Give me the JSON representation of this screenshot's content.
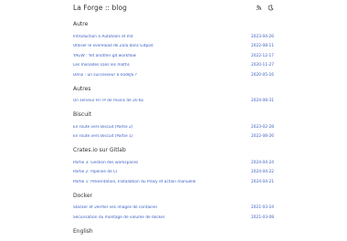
{
  "header": {
    "title": "La Forge :: blog",
    "icons": [
      "rss-icon",
      "moon-icon"
    ]
  },
  "categories": [
    {
      "name": "Autre",
      "posts": [
        {
          "title": "Introduction à Autotools et m4",
          "date": "2023-04-26"
        },
        {
          "title": "Utiliser le livereload de Zola dans Gitpod",
          "date": "2022-08-11"
        },
        {
          "title": "YAGW : Yet another git workflow",
          "date": "2022-12-17"
        },
        {
          "title": "Les monades sans les maths",
          "date": "2020-11-27"
        },
        {
          "title": "Deno : un successeur à nodeJS ?",
          "date": "2020-05-16"
        }
      ]
    },
    {
      "name": "Autres",
      "posts": [
        {
          "title": "Un serveur HTTP de moins de 20 Ko",
          "date": "2024-08-31"
        }
      ]
    },
    {
      "name": "Biscuit",
      "posts": [
        {
          "title": "En route vers Biscuit (Partie 2)",
          "date": "2023-02-28"
        },
        {
          "title": "En route vers Biscuit (Partie 1)",
          "date": "2022-08-26"
        }
      ]
    },
    {
      "name": "Crates.io sur Gitlab",
      "posts": [
        {
          "title": "Partie 3: Gestion des workspaces",
          "date": "2024-04-24"
        },
        {
          "title": "Partie 2: Pipeline de CI",
          "date": "2024-04-22"
        },
        {
          "title": "Partie 1: Présentation, Installation du Proxy et action manuelle",
          "date": "2024-04-21"
        }
      ]
    },
    {
      "name": "Docker",
      "posts": [
        {
          "title": "Stocker et vérifier ses images de container",
          "date": "2021-03-24"
        },
        {
          "title": "Sécurisation du montage de volume de docker",
          "date": "2021-03-08"
        }
      ]
    },
    {
      "name": "English",
      "posts": []
    }
  ],
  "colors": {
    "link": "#3b5fc4",
    "text": "#333333",
    "background": "#ffffff"
  }
}
